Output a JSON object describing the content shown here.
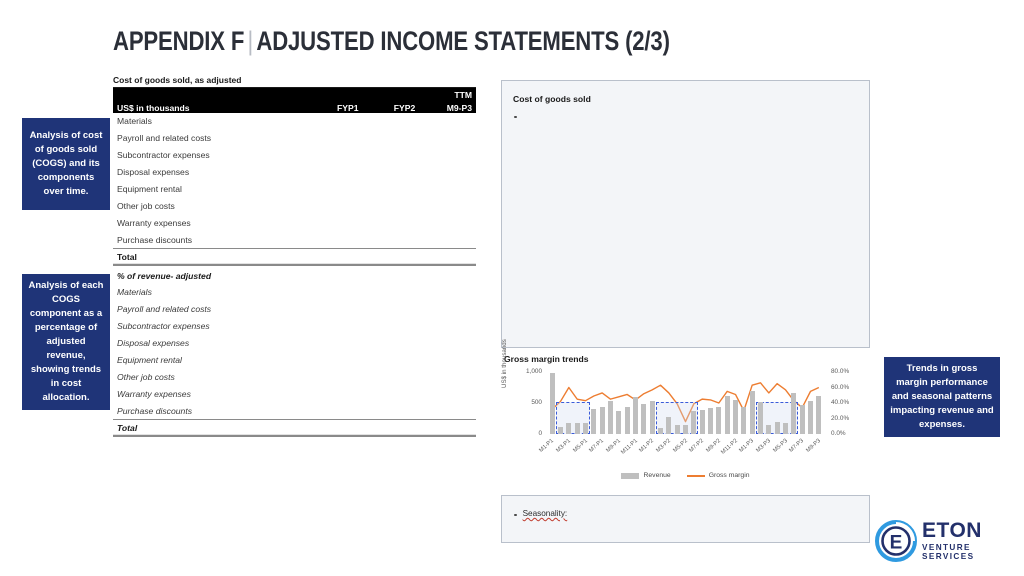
{
  "slide": {
    "title_main": "APPENDIX F",
    "title_sep": "|",
    "title_rest": "ADJUSTED INCOME STATEMENTS (2/3)",
    "accent_navy": "#1f3478",
    "accent_orange": "#ed7d31",
    "accent_gray_bar": "#bfbfbf",
    "highlight_blue": "#3a5bd9"
  },
  "callouts": [
    {
      "id": "callout-1",
      "text": "Analysis of cost of goods sold (COGS) and its components over time."
    },
    {
      "id": "callout-2",
      "text": "Analysis of each COGS component as a percentage of adjusted revenue, showing trends in cost allocation."
    },
    {
      "id": "callout-3",
      "text": "Trends in gross margin performance and seasonal patterns impacting revenue and expenses."
    }
  ],
  "table": {
    "caption": "Cost of goods sold, as adjusted",
    "header": {
      "label": "US$ in thousands",
      "col1": "FYP1",
      "col2": "FYP2",
      "col3_top": "TTM",
      "col3_bottom": "M9-P3"
    },
    "section1": {
      "rows": [
        {
          "label": "Materials",
          "fyp1": "",
          "fyp2": "",
          "ttm": ""
        },
        {
          "label": "Payroll and related costs",
          "fyp1": "",
          "fyp2": "",
          "ttm": ""
        },
        {
          "label": "Subcontractor expenses",
          "fyp1": "",
          "fyp2": "",
          "ttm": ""
        },
        {
          "label": "Disposal expenses",
          "fyp1": "",
          "fyp2": "",
          "ttm": ""
        },
        {
          "label": "Equipment rental",
          "fyp1": "",
          "fyp2": "",
          "ttm": ""
        },
        {
          "label": "Other job costs",
          "fyp1": "",
          "fyp2": "",
          "ttm": ""
        },
        {
          "label": "Warranty expenses",
          "fyp1": "",
          "fyp2": "",
          "ttm": ""
        },
        {
          "label": "Purchase discounts",
          "fyp1": "",
          "fyp2": "",
          "ttm": ""
        }
      ],
      "total_label": "Total",
      "total_fyp1": "",
      "total_fyp2": "",
      "total_ttm": ""
    },
    "section2": {
      "heading": "% of revenue- adjusted",
      "rows": [
        {
          "label": "Materials",
          "fyp1": "",
          "fyp2": "",
          "ttm": ""
        },
        {
          "label": "Payroll and related costs",
          "fyp1": "",
          "fyp2": "",
          "ttm": ""
        },
        {
          "label": "Subcontractor expenses",
          "fyp1": "",
          "fyp2": "",
          "ttm": ""
        },
        {
          "label": "Disposal expenses",
          "fyp1": "",
          "fyp2": "",
          "ttm": ""
        },
        {
          "label": "Equipment rental",
          "fyp1": "",
          "fyp2": "",
          "ttm": ""
        },
        {
          "label": "Other job costs",
          "fyp1": "",
          "fyp2": "",
          "ttm": ""
        },
        {
          "label": "Warranty expenses",
          "fyp1": "",
          "fyp2": "",
          "ttm": ""
        },
        {
          "label": "Purchase discounts",
          "fyp1": "",
          "fyp2": "",
          "ttm": ""
        }
      ],
      "total_label": "Total",
      "total_fyp1": "",
      "total_fyp2": "",
      "total_ttm": ""
    }
  },
  "cogs_panel": {
    "title": "Cost of goods sold",
    "bullets": [
      {
        "text": ""
      }
    ]
  },
  "seasonality_panel": {
    "bullets": [
      {
        "label": "Seasonality:",
        "text": ""
      }
    ]
  },
  "chart_data": {
    "type": "bar",
    "title": "Gross margin trends",
    "xlabel": "",
    "ylabel": "US$ in thousands",
    "y2label": "",
    "ylim": [
      0,
      1000
    ],
    "y2lim": [
      0,
      0.8
    ],
    "yticks": [
      "0",
      "500",
      "1,000"
    ],
    "y2ticks": [
      "0.0%",
      "20.0%",
      "40.0%",
      "60.0%",
      "80.0%"
    ],
    "grid": false,
    "legend_position": "bottom",
    "categories": [
      "M1-P1",
      "M2-P1",
      "M3-P1",
      "M4-P1",
      "M5-P1",
      "M6-P1",
      "M7-P1",
      "M8-P1",
      "M9-P1",
      "M10-P1",
      "M11-P1",
      "M12-P1",
      "M1-P2",
      "M2-P2",
      "M3-P2",
      "M4-P2",
      "M5-P2",
      "M6-P2",
      "M7-P2",
      "M8-P2",
      "M9-P2",
      "M10-P2",
      "M11-P2",
      "M12-P2",
      "M1-P3",
      "M2-P3",
      "M3-P3",
      "M4-P3",
      "M5-P3",
      "M6-P3",
      "M7-P3",
      "M8-P3",
      "M9-P3"
    ],
    "tick_labels": [
      "M1-P1",
      "M3-P1",
      "M5-P1",
      "M7-P1",
      "M9-P1",
      "M11-P1",
      "M1-P2",
      "M3-P2",
      "M5-P2",
      "M7-P2",
      "M9-P2",
      "M11-P2",
      "M1-P3",
      "M3-P3",
      "M5-P3",
      "M7-P3",
      "M9-P3"
    ],
    "series": [
      {
        "name": "Revenue",
        "type": "bar",
        "color": "#bfbfbf",
        "axis": "left",
        "values": [
          980,
          110,
          185,
          175,
          180,
          400,
          430,
          530,
          370,
          435,
          600,
          490,
          525,
          105,
          275,
          145,
          150,
          365,
          395,
          420,
          440,
          610,
          545,
          430,
          700,
          520,
          145,
          195,
          175,
          660,
          475,
          525,
          610
        ]
      },
      {
        "name": "Gross margin",
        "type": "line",
        "color": "#ed7d31",
        "axis": "right",
        "values": [
          0.32,
          0.42,
          0.6,
          0.45,
          0.43,
          0.49,
          0.53,
          0.45,
          0.48,
          0.51,
          0.44,
          0.52,
          0.57,
          0.63,
          0.53,
          0.39,
          0.16,
          0.39,
          0.45,
          0.44,
          0.4,
          0.55,
          0.51,
          0.3,
          0.63,
          0.66,
          0.53,
          0.65,
          0.57,
          0.43,
          0.34,
          0.55,
          0.6
        ]
      }
    ],
    "highlights": [
      {
        "label": "seasonal-low-p1",
        "start_index": 1,
        "end_index": 4
      },
      {
        "label": "seasonal-low-p2",
        "start_index": 13,
        "end_index": 17
      },
      {
        "label": "seasonal-low-p3",
        "start_index": 25,
        "end_index": 29
      }
    ]
  },
  "logo": {
    "mark_letter": "E",
    "name": "ETON",
    "subtitle": "VENTURE SERVICES"
  }
}
